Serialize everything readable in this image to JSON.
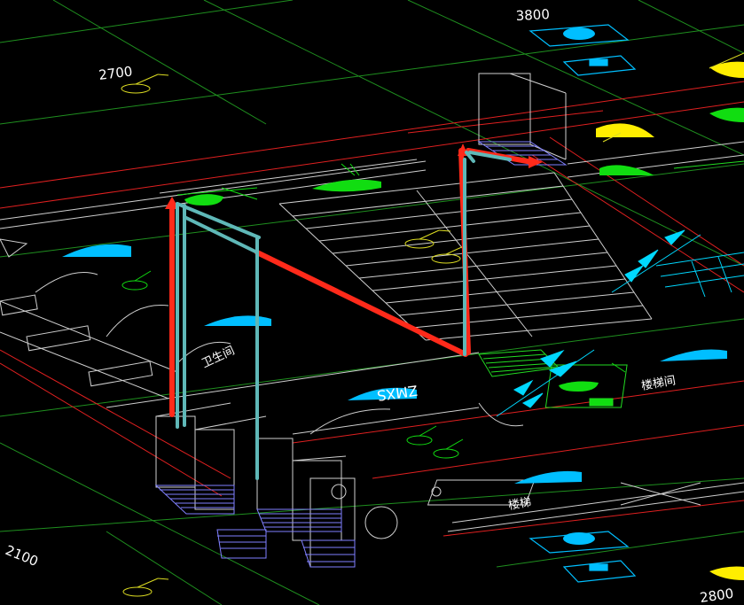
{
  "drawing": {
    "background": "#000000",
    "elevations": {
      "top_left": "2700",
      "top_right": "3800",
      "bottom_left": "2100",
      "bottom_right": "2800"
    },
    "room_labels": {
      "stair": "楼梯",
      "stair_hall": "楼梯间",
      "toilet": "卫生间",
      "room_code": "ZMXS"
    },
    "colors": {
      "grid_line": "#1f8f1f",
      "wall_red": "#e02020",
      "wall_white": "#d0d0d0",
      "pipe_red": "#ff2a1a",
      "pipe_cyan": "#5fb8b8",
      "light_fixture": "#00bfff",
      "fixture_green": "#11dd11",
      "fixture_yellow": "#ffee00",
      "tag_yellow": "#dddd22",
      "hatch_blue": "#8080ff"
    }
  }
}
